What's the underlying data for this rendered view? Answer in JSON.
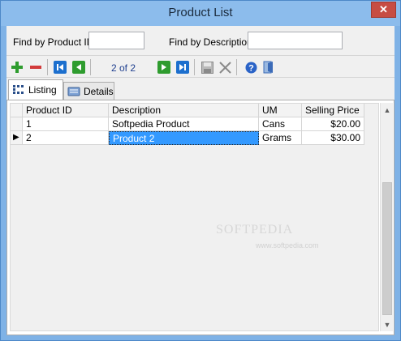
{
  "window": {
    "title": "Product List",
    "close_glyph": "✕"
  },
  "find": {
    "product_id_label": "Find by Product ID",
    "product_id_value": "",
    "description_label": "Find by Description",
    "description_value": ""
  },
  "toolbar": {
    "buttons": [
      {
        "name": "add-record",
        "icon": "plus-icon",
        "color": "#2e9c2e"
      },
      {
        "name": "delete-record",
        "icon": "minus-icon",
        "color": "#d23b3b"
      },
      {
        "name": "first-record",
        "icon": "first-icon",
        "color": "#1c6fce"
      },
      {
        "name": "previous-record",
        "icon": "previous-icon",
        "color": "#2e9c2e"
      },
      {
        "name": "next-record",
        "icon": "next-icon",
        "color": "#2e9c2e"
      },
      {
        "name": "last-record",
        "icon": "last-icon",
        "color": "#1c6fce"
      },
      {
        "name": "save-record",
        "icon": "save-icon",
        "color": "#8a8a8a"
      },
      {
        "name": "cancel-edit",
        "icon": "cancel-icon",
        "color": "#8a8a8a"
      },
      {
        "name": "help",
        "icon": "help-icon",
        "color": "#2a63c7"
      },
      {
        "name": "exit",
        "icon": "exit-icon",
        "color": "#3b6bb8"
      }
    ],
    "page_indicator": "2 of 2"
  },
  "tabs": [
    {
      "label": "Listing",
      "icon": "grid-icon",
      "active": true
    },
    {
      "label": "Details",
      "icon": "details-icon",
      "active": false
    }
  ],
  "grid": {
    "columns": [
      "Product ID",
      "Description",
      "UM",
      "Selling Price"
    ],
    "rows": [
      {
        "product_id": "1",
        "description": "Softpedia Product",
        "um": "Cans",
        "price": "$20.00",
        "current": false
      },
      {
        "product_id": "2",
        "description": "Product 2",
        "um": "Grams",
        "price": "$30.00",
        "current": true
      }
    ],
    "current_row_marker": "▶"
  },
  "watermark": {
    "text": "SOFTPEDIA",
    "sub": "www.softpedia.com"
  },
  "colors": {
    "selection": "#3399ff",
    "title_bar": "#8cbcec",
    "close_button": "#c74d43"
  }
}
